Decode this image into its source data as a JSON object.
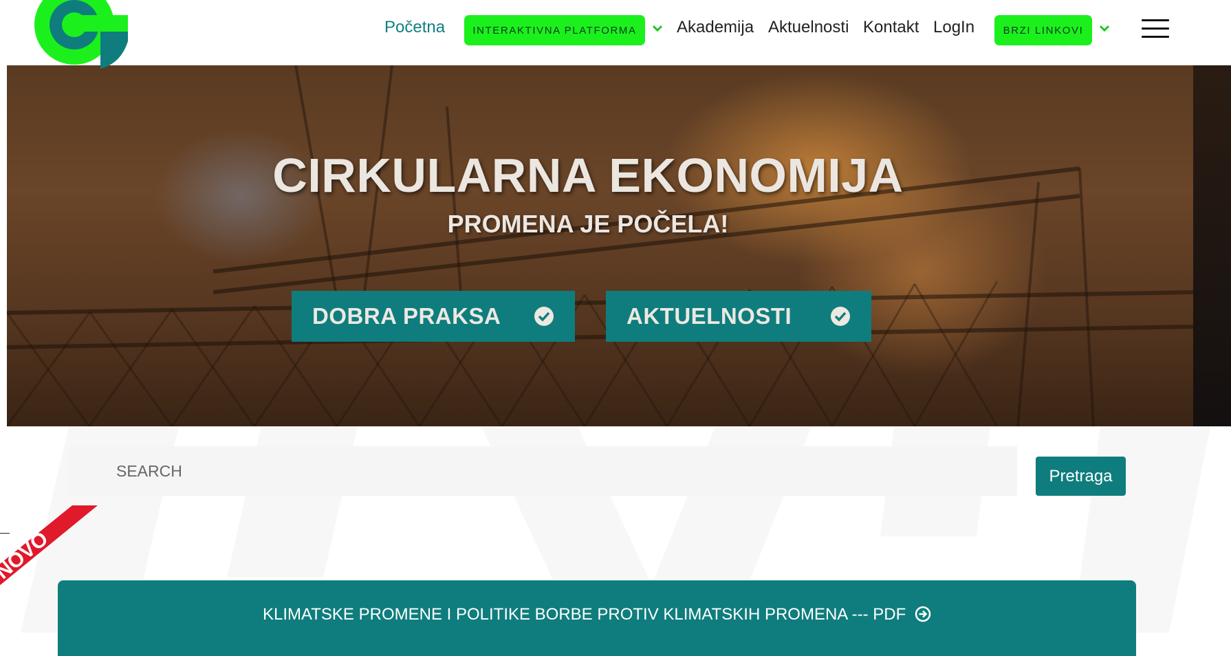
{
  "nav": {
    "home_label": "Početna",
    "platform_label": "INTERAKTIVNA PLATFORMA",
    "academy_label": "Akademija",
    "news_label": "Aktuelnosti",
    "contact_label": "Kontakt",
    "login_label": "LogIn",
    "quick_links_label": "BRZI LINKOVI"
  },
  "hero": {
    "title": "CIRKULARNA EKONOMIJA",
    "subtitle": "PROMENA JE POČELA!",
    "buttons": [
      {
        "label": "DOBRA PRAKSA",
        "icon": "check-circle-icon"
      },
      {
        "label": "AKTUELNOSTI",
        "icon": "check-circle-icon"
      }
    ]
  },
  "search": {
    "placeholder": "SEARCH",
    "button_label": "Pretraga"
  },
  "ribbon": {
    "label": "NOVO"
  },
  "pdf_banner": {
    "label": "KLIMATSKE PROMENE I POLITIKE BORBE PROTIV KLIMATSKIH PROMENA --- PDF",
    "icon": "arrow-circle-right-icon"
  },
  "colors": {
    "teal": "#0f7d7d",
    "green_accent": "#1cf01c",
    "ribbon_red": "#e0192b"
  }
}
